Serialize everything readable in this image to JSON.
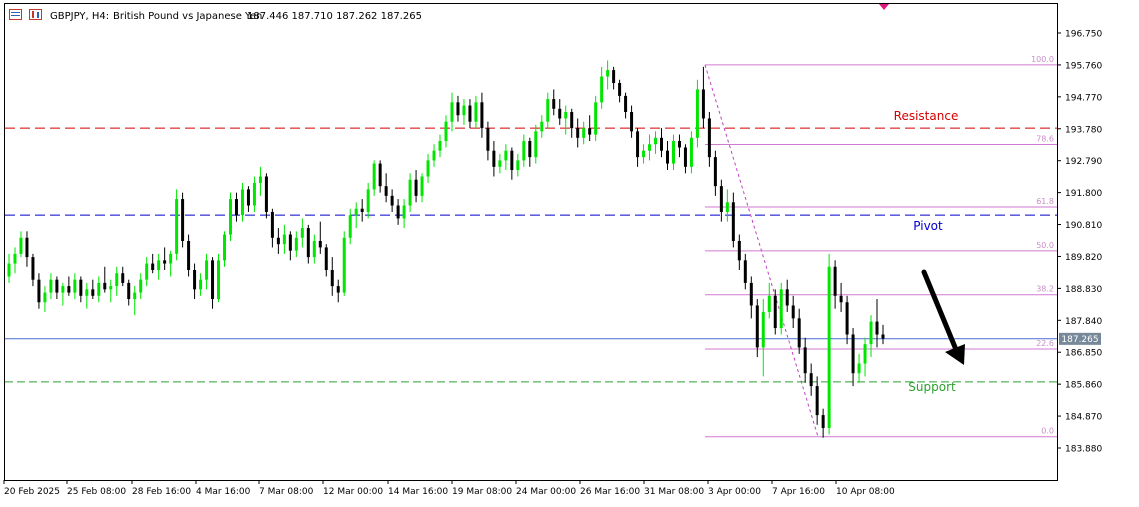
{
  "header": {
    "symbol_label": "GBPJPY, H4:",
    "description": "British Pound vs Japanese Yen",
    "ohlc": "187.446 187.710 187.262 187.265"
  },
  "chart_data": {
    "type": "candlestick",
    "symbol": "GBPJPY",
    "timeframe": "H4",
    "ylim": [
      183.42,
      197.26
    ],
    "y_ticks": [
      "196.750",
      "195.760",
      "194.770",
      "193.780",
      "192.790",
      "191.800",
      "190.810",
      "189.820",
      "188.830",
      "187.840",
      "186.850",
      "185.860",
      "184.870",
      "183.880"
    ],
    "x_ticks": [
      "20 Feb 2025",
      "25 Feb 08:00",
      "28 Feb 16:00",
      "4 Mar 16:00",
      "7 Mar 08:00",
      "12 Mar 00:00",
      "14 Mar 16:00",
      "19 Mar 08:00",
      "24 Mar 00:00",
      "26 Mar 16:00",
      "31 Mar 08:00",
      "3 Apr 00:00",
      "7 Apr 16:00",
      "10 Apr 08:00"
    ],
    "current_price": "187.265",
    "levels": [
      {
        "name": "Resistance",
        "price": 193.8,
        "color": "#d40000",
        "label": "Resistance"
      },
      {
        "name": "Pivot",
        "price": 191.1,
        "color": "#0000cc",
        "label": "Pivot"
      },
      {
        "name": "Support",
        "price": 185.93,
        "color": "#2ca02c",
        "label": "Support"
      },
      {
        "name": "Horizontal",
        "price": 187.27,
        "color": "#4a6fd1",
        "label": ""
      }
    ],
    "fibonacci": {
      "high": 195.76,
      "low": 184.23,
      "line_color": "#d07ad0",
      "levels": [
        {
          "ratio": 1.0,
          "label": "100.0"
        },
        {
          "ratio": 0.786,
          "label": "78.6"
        },
        {
          "ratio": 0.618,
          "label": "61.8"
        },
        {
          "ratio": 0.5,
          "label": "50.0"
        },
        {
          "ratio": 0.382,
          "label": "38.2"
        },
        {
          "ratio": 0.236,
          "label": "22.6"
        },
        {
          "ratio": 0.0,
          "label": "0.0"
        }
      ]
    },
    "candles": [
      [
        189.2,
        189.9,
        189.0,
        189.6
      ],
      [
        189.6,
        190.1,
        189.3,
        189.9
      ],
      [
        189.9,
        190.6,
        189.8,
        190.4
      ],
      [
        190.4,
        190.6,
        189.5,
        189.8
      ],
      [
        189.8,
        189.9,
        188.9,
        189.1
      ],
      [
        189.1,
        189.3,
        188.2,
        188.4
      ],
      [
        188.4,
        188.9,
        188.1,
        188.7
      ],
      [
        188.7,
        189.3,
        188.5,
        189.1
      ],
      [
        189.1,
        189.2,
        188.5,
        188.7
      ],
      [
        188.7,
        189.0,
        188.3,
        188.9
      ],
      [
        188.9,
        189.2,
        188.6,
        188.7
      ],
      [
        188.7,
        189.3,
        188.5,
        189.1
      ],
      [
        189.1,
        189.2,
        188.4,
        188.6
      ],
      [
        188.6,
        189.0,
        188.2,
        188.8
      ],
      [
        188.8,
        189.1,
        188.5,
        188.6
      ],
      [
        188.6,
        189.2,
        188.4,
        189.0
      ],
      [
        189.0,
        189.5,
        188.7,
        188.8
      ],
      [
        188.8,
        189.1,
        188.4,
        188.9
      ],
      [
        188.9,
        189.5,
        188.6,
        189.3
      ],
      [
        189.3,
        189.5,
        188.9,
        189.0
      ],
      [
        189.0,
        189.1,
        188.3,
        188.5
      ],
      [
        188.5,
        188.9,
        188.0,
        188.7
      ],
      [
        188.7,
        189.3,
        188.5,
        189.1
      ],
      [
        189.1,
        189.8,
        188.9,
        189.6
      ],
      [
        189.6,
        189.9,
        189.3,
        189.4
      ],
      [
        189.4,
        189.9,
        189.1,
        189.7
      ],
      [
        189.7,
        190.1,
        189.4,
        189.6
      ],
      [
        189.6,
        190.0,
        189.2,
        189.9
      ],
      [
        189.9,
        191.9,
        189.7,
        191.6
      ],
      [
        191.6,
        191.8,
        190.1,
        190.3
      ],
      [
        190.3,
        190.5,
        189.2,
        189.4
      ],
      [
        189.4,
        189.6,
        188.5,
        188.8
      ],
      [
        188.8,
        189.3,
        188.6,
        189.1
      ],
      [
        189.1,
        189.9,
        188.8,
        189.7
      ],
      [
        189.7,
        189.8,
        188.2,
        188.5
      ],
      [
        188.5,
        189.9,
        188.4,
        189.7
      ],
      [
        189.7,
        190.6,
        189.5,
        190.5
      ],
      [
        190.5,
        191.8,
        190.3,
        191.6
      ],
      [
        191.6,
        191.8,
        190.9,
        191.1
      ],
      [
        191.1,
        192.1,
        190.9,
        191.9
      ],
      [
        191.9,
        192.0,
        191.2,
        191.4
      ],
      [
        191.4,
        192.3,
        191.2,
        192.1
      ],
      [
        192.1,
        192.6,
        191.7,
        192.3
      ],
      [
        192.3,
        192.4,
        191.0,
        191.2
      ],
      [
        191.2,
        191.3,
        190.1,
        190.4
      ],
      [
        190.4,
        190.7,
        189.9,
        190.2
      ],
      [
        190.2,
        190.8,
        189.9,
        190.5
      ],
      [
        190.5,
        190.6,
        189.7,
        190.0
      ],
      [
        190.0,
        190.6,
        189.8,
        190.4
      ],
      [
        190.4,
        191.0,
        190.1,
        190.7
      ],
      [
        190.7,
        190.8,
        189.6,
        189.8
      ],
      [
        189.8,
        190.5,
        189.6,
        190.3
      ],
      [
        190.3,
        190.9,
        189.9,
        190.1
      ],
      [
        190.1,
        190.2,
        189.2,
        189.4
      ],
      [
        189.4,
        189.8,
        188.6,
        188.9
      ],
      [
        188.9,
        189.1,
        188.4,
        188.7
      ],
      [
        188.7,
        190.6,
        188.6,
        190.4
      ],
      [
        190.4,
        191.3,
        190.2,
        191.1
      ],
      [
        191.1,
        191.5,
        190.7,
        191.3
      ],
      [
        191.3,
        191.6,
        190.9,
        191.2
      ],
      [
        191.2,
        192.1,
        191.0,
        191.9
      ],
      [
        191.9,
        192.8,
        191.7,
        192.7
      ],
      [
        192.7,
        192.8,
        191.8,
        192.0
      ],
      [
        192.0,
        192.4,
        191.5,
        191.7
      ],
      [
        191.7,
        191.9,
        191.2,
        191.4
      ],
      [
        191.4,
        191.6,
        190.8,
        191.0
      ],
      [
        191.0,
        191.6,
        190.7,
        191.4
      ],
      [
        191.4,
        192.4,
        191.2,
        192.2
      ],
      [
        192.2,
        192.5,
        191.5,
        191.7
      ],
      [
        191.7,
        192.4,
        191.5,
        192.3
      ],
      [
        192.3,
        193.0,
        192.1,
        192.8
      ],
      [
        192.8,
        193.3,
        192.6,
        193.1
      ],
      [
        193.1,
        193.6,
        192.9,
        193.4
      ],
      [
        193.4,
        194.2,
        193.2,
        194.0
      ],
      [
        194.0,
        194.9,
        193.7,
        194.6
      ],
      [
        194.6,
        194.8,
        194.0,
        194.2
      ],
      [
        194.2,
        194.7,
        193.9,
        194.5
      ],
      [
        194.5,
        194.7,
        193.8,
        194.0
      ],
      [
        194.0,
        194.8,
        193.8,
        194.6
      ],
      [
        194.6,
        194.9,
        193.5,
        193.8
      ],
      [
        193.8,
        194.0,
        192.8,
        193.1
      ],
      [
        193.1,
        193.4,
        192.3,
        192.6
      ],
      [
        192.6,
        193.0,
        192.4,
        192.8
      ],
      [
        192.8,
        193.3,
        192.5,
        193.1
      ],
      [
        193.1,
        193.2,
        192.2,
        192.5
      ],
      [
        192.5,
        193.0,
        192.3,
        192.8
      ],
      [
        192.8,
        193.6,
        192.6,
        193.4
      ],
      [
        193.4,
        193.5,
        192.6,
        192.9
      ],
      [
        192.9,
        193.9,
        192.7,
        193.7
      ],
      [
        193.7,
        194.2,
        193.5,
        194.0
      ],
      [
        194.0,
        194.9,
        193.8,
        194.7
      ],
      [
        194.7,
        195.0,
        194.2,
        194.4
      ],
      [
        194.4,
        194.7,
        193.9,
        194.1
      ],
      [
        194.1,
        194.5,
        193.6,
        194.3
      ],
      [
        194.3,
        194.4,
        193.5,
        193.8
      ],
      [
        193.8,
        194.1,
        193.2,
        193.5
      ],
      [
        193.5,
        194.0,
        193.3,
        193.8
      ],
      [
        193.8,
        194.2,
        193.4,
        193.6
      ],
      [
        193.6,
        194.8,
        193.4,
        194.6
      ],
      [
        194.6,
        195.7,
        194.4,
        195.4
      ],
      [
        195.4,
        195.9,
        195.0,
        195.6
      ],
      [
        195.6,
        195.7,
        195.0,
        195.2
      ],
      [
        195.2,
        195.3,
        194.6,
        194.8
      ],
      [
        194.8,
        194.9,
        194.1,
        194.3
      ],
      [
        194.3,
        194.5,
        193.5,
        193.7
      ],
      [
        193.7,
        193.8,
        192.6,
        192.9
      ],
      [
        192.9,
        193.3,
        192.7,
        193.1
      ],
      [
        193.1,
        193.6,
        192.8,
        193.3
      ],
      [
        193.3,
        193.7,
        193.0,
        193.5
      ],
      [
        193.5,
        193.8,
        192.9,
        193.1
      ],
      [
        193.1,
        193.4,
        192.5,
        192.7
      ],
      [
        192.7,
        193.6,
        192.5,
        193.4
      ],
      [
        193.4,
        193.6,
        192.9,
        193.2
      ],
      [
        193.2,
        193.3,
        192.4,
        192.6
      ],
      [
        192.6,
        193.7,
        192.4,
        193.5
      ],
      [
        193.5,
        195.3,
        193.2,
        195.0
      ],
      [
        195.0,
        195.7,
        193.8,
        194.1
      ],
      [
        194.1,
        194.3,
        192.6,
        192.9
      ],
      [
        192.9,
        193.1,
        191.7,
        192.0
      ],
      [
        192.0,
        192.2,
        190.9,
        191.2
      ],
      [
        191.2,
        191.9,
        190.9,
        191.5
      ],
      [
        191.5,
        191.8,
        190.1,
        190.3
      ],
      [
        190.3,
        190.5,
        189.4,
        189.7
      ],
      [
        189.7,
        189.9,
        188.8,
        189.0
      ],
      [
        189.0,
        189.2,
        187.9,
        188.3
      ],
      [
        188.3,
        188.5,
        186.7,
        187.0
      ],
      [
        187.0,
        188.5,
        186.1,
        188.1
      ],
      [
        188.1,
        189.0,
        187.9,
        188.6
      ],
      [
        188.6,
        188.8,
        187.4,
        187.6
      ],
      [
        187.6,
        189.0,
        187.4,
        188.8
      ],
      [
        188.8,
        189.1,
        188.1,
        188.3
      ],
      [
        188.3,
        188.6,
        187.6,
        187.9
      ],
      [
        187.9,
        188.2,
        186.8,
        187.0
      ],
      [
        187.0,
        187.3,
        185.9,
        186.2
      ],
      [
        186.2,
        186.5,
        185.5,
        185.8
      ],
      [
        185.8,
        186.1,
        184.6,
        184.9
      ],
      [
        184.9,
        185.1,
        184.2,
        184.5
      ],
      [
        184.5,
        189.9,
        184.3,
        189.5
      ],
      [
        189.5,
        189.7,
        188.2,
        188.6
      ],
      [
        188.6,
        189.0,
        188.1,
        188.4
      ],
      [
        188.4,
        188.6,
        187.1,
        187.4
      ],
      [
        187.4,
        187.6,
        185.8,
        186.2
      ],
      [
        186.2,
        186.8,
        185.9,
        186.5
      ],
      [
        186.5,
        187.3,
        186.1,
        187.1
      ],
      [
        187.1,
        188.0,
        186.7,
        187.8
      ],
      [
        187.8,
        188.5,
        187.0,
        187.4
      ],
      [
        187.4,
        187.7,
        187.1,
        187.27
      ]
    ]
  }
}
